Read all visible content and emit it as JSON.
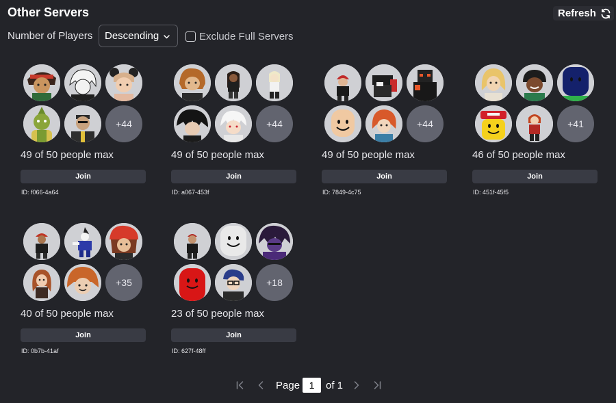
{
  "header": {
    "title": "Other Servers",
    "refresh_label": "Refresh"
  },
  "filters": {
    "sort_label": "Number of Players",
    "sort_value": "Descending",
    "exclude_label": "Exclude Full Servers",
    "exclude_checked": false
  },
  "servers": [
    {
      "more": "+44",
      "players": "49 of 50 people max",
      "join": "Join",
      "id": "ID: f066-4a64"
    },
    {
      "more": "+44",
      "players": "49 of 50 people max",
      "join": "Join",
      "id": "ID: a067-453f"
    },
    {
      "more": "+44",
      "players": "49 of 50 people max",
      "join": "Join",
      "id": "ID: 7849-4c75"
    },
    {
      "more": "+41",
      "players": "46 of 50 people max",
      "join": "Join",
      "id": "ID: 451f-45f5"
    },
    {
      "more": "+35",
      "players": "40 of 50 people max",
      "join": "Join",
      "id": "ID: 0b7b-41af"
    },
    {
      "more": "+18",
      "players": "23 of 50 people max",
      "join": "Join",
      "id": "ID: 627f-48ff"
    }
  ],
  "pagination": {
    "page_label": "Page",
    "current_page": "1",
    "of_label": "of 1"
  },
  "colors": {
    "background": "#232429",
    "join_button": "#393b44",
    "more_badge": "#62646f",
    "avatar_bg": "#cfd0d4"
  }
}
